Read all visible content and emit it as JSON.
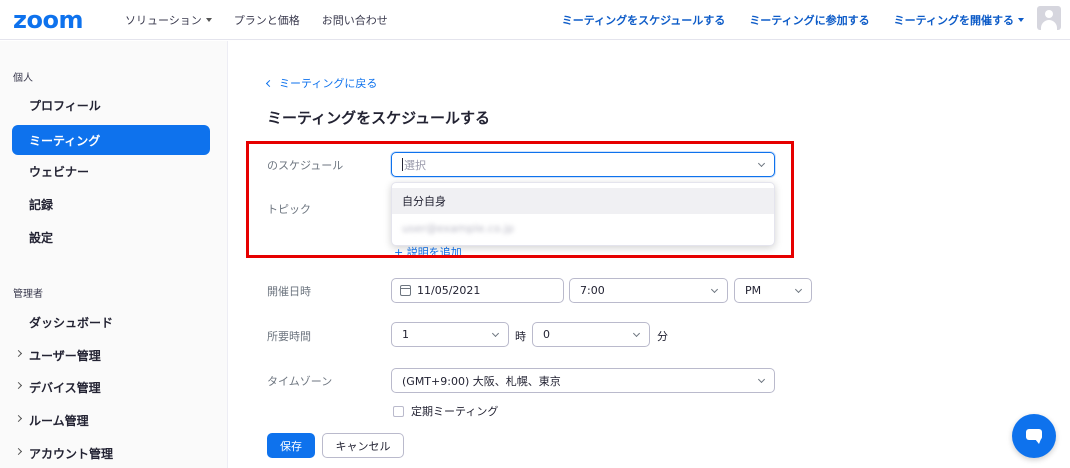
{
  "header": {
    "logo": "zoom",
    "nav_left": [
      "ソリューション",
      "プランと価格",
      "お問い合わせ"
    ],
    "nav_right": [
      "ミーティングをスケジュールする",
      "ミーティングに参加する",
      "ミーティングを開催する"
    ]
  },
  "sidebar": {
    "section_personal": "個人",
    "personal_items": [
      "プロフィール",
      "ミーティング",
      "ウェビナー",
      "記録",
      "設定"
    ],
    "section_admin": "管理者",
    "admin_items": [
      "ダッシュボード",
      "ユーザー管理",
      "デバイス管理",
      "ルーム管理",
      "アカウント管理"
    ]
  },
  "main": {
    "back_link": "ミーティングに戻る",
    "title": "ミーティングをスケジュールする",
    "schedule_for": {
      "label": "のスケジュール",
      "placeholder": "選択",
      "options": [
        "自分自身",
        "user@example.co.jp"
      ]
    },
    "topic_label": "トピック",
    "add_description": "+ 説明を追加",
    "datetime": {
      "label": "開催日時",
      "date": "11/05/2021",
      "time": "7:00",
      "ampm": "PM"
    },
    "duration": {
      "label": "所要時間",
      "hours": "1",
      "hours_unit": "時",
      "minutes": "0",
      "minutes_unit": "分"
    },
    "timezone": {
      "label": "タイムゾーン",
      "value": "(GMT+9:00) 大阪、札幌、東京"
    },
    "recurring_label": "定期ミーティング",
    "save_label": "保存",
    "cancel_label": "キャンセル"
  },
  "colors": {
    "brand": "#0e72ed",
    "highlight_box": "#e60000"
  }
}
